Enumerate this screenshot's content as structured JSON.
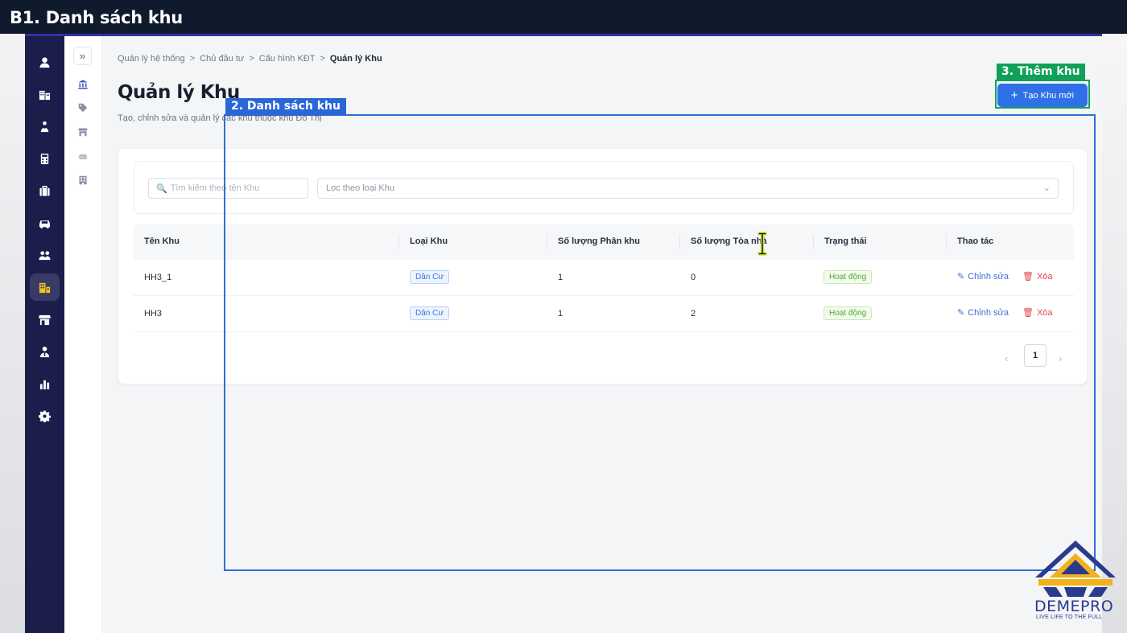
{
  "overlay": {
    "step_title": "B1. Danh sách khu",
    "list_annotation": "2. Danh sách khu",
    "add_annotation": "3. Thêm khu",
    "list_color": "#2a66d6",
    "add_color": "#10a058"
  },
  "rail": {
    "items": [
      {
        "icon": "user-icon"
      },
      {
        "icon": "buildings-icon"
      },
      {
        "icon": "investor-icon"
      },
      {
        "icon": "calculator-icon"
      },
      {
        "icon": "briefcase-icon"
      },
      {
        "icon": "car-icon"
      },
      {
        "icon": "users-icon"
      },
      {
        "icon": "apartment-icon",
        "active": true
      },
      {
        "icon": "store-icon"
      },
      {
        "icon": "user-tie-icon"
      },
      {
        "icon": "bar-chart-icon"
      },
      {
        "icon": "gear-icon"
      }
    ],
    "accent": "#f5c518"
  },
  "subnav": {
    "collapse_label": "»",
    "items": [
      {
        "icon": "bank-icon",
        "active": true
      },
      {
        "icon": "tag-icon"
      },
      {
        "icon": "shop-icon"
      },
      {
        "icon": "parking-icon"
      },
      {
        "icon": "building-icon"
      }
    ]
  },
  "breadcrumb": {
    "items": [
      "Quản lý hệ thống",
      "Chủ đầu tư",
      "Cấu hình KĐT"
    ],
    "separator": ">",
    "current": "Quản lý Khu"
  },
  "page": {
    "title": "Quản lý Khu",
    "subtitle": "Tạo, chỉnh sửa và quản lý các khu thuộc khu Đô Thị",
    "create_button": "Tạo Khu mới",
    "primary_color": "#2f6fe8"
  },
  "filters": {
    "search_placeholder": "Tìm kiếm theo tên Khu",
    "type_placeholder": "Lọc theo loại Khu"
  },
  "table": {
    "columns": [
      "Tên Khu",
      "Loại Khu",
      "Số lượng Phân khu",
      "Số lượng Tòa nhà",
      "Trạng thái",
      "Thao tác"
    ],
    "rows": [
      {
        "name": "HH3_1",
        "type": "Dân Cư",
        "sub_zones": "1",
        "buildings": "0",
        "status": "Hoạt động"
      },
      {
        "name": "HH3",
        "type": "Dân Cư",
        "sub_zones": "1",
        "buildings": "2",
        "status": "Hoạt động"
      }
    ],
    "edit_label": "Chỉnh sửa",
    "delete_label": "Xóa"
  },
  "pagination": {
    "current_page": "1",
    "prev": "‹",
    "next": "›"
  },
  "logo": {
    "name": "DEMEPRO",
    "tagline": "LIVE LIFE TO THE FULL"
  }
}
